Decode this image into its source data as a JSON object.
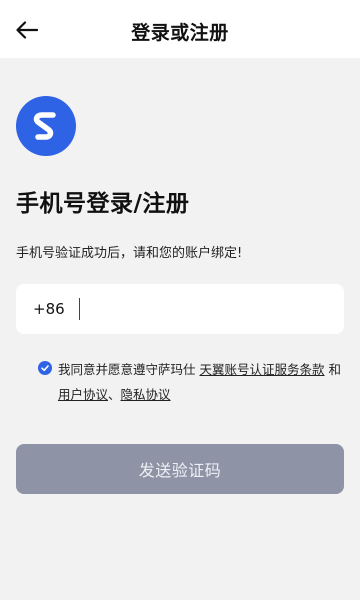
{
  "header": {
    "back_icon": "arrow-left-icon",
    "title": "登录或注册"
  },
  "brand": {
    "logo_icon": "brand-s-logo-icon",
    "accent_color": "#2f63e6"
  },
  "main": {
    "title": "手机号登录/注册",
    "subtitle": "手机号验证成功后，请和您的账户绑定!"
  },
  "phone": {
    "country_code": "+86",
    "value": "",
    "placeholder": ""
  },
  "agreement": {
    "checked": true,
    "prefix": "我同意并愿意遵守萨玛仕 ",
    "link1": "天翼账号认证服务条款",
    "middle": " 和",
    "link2": "用户协议",
    "separator": "、",
    "link3": "隐私协议"
  },
  "actions": {
    "send_code_label": "发送验证码",
    "button_color": "#8e94a6"
  }
}
